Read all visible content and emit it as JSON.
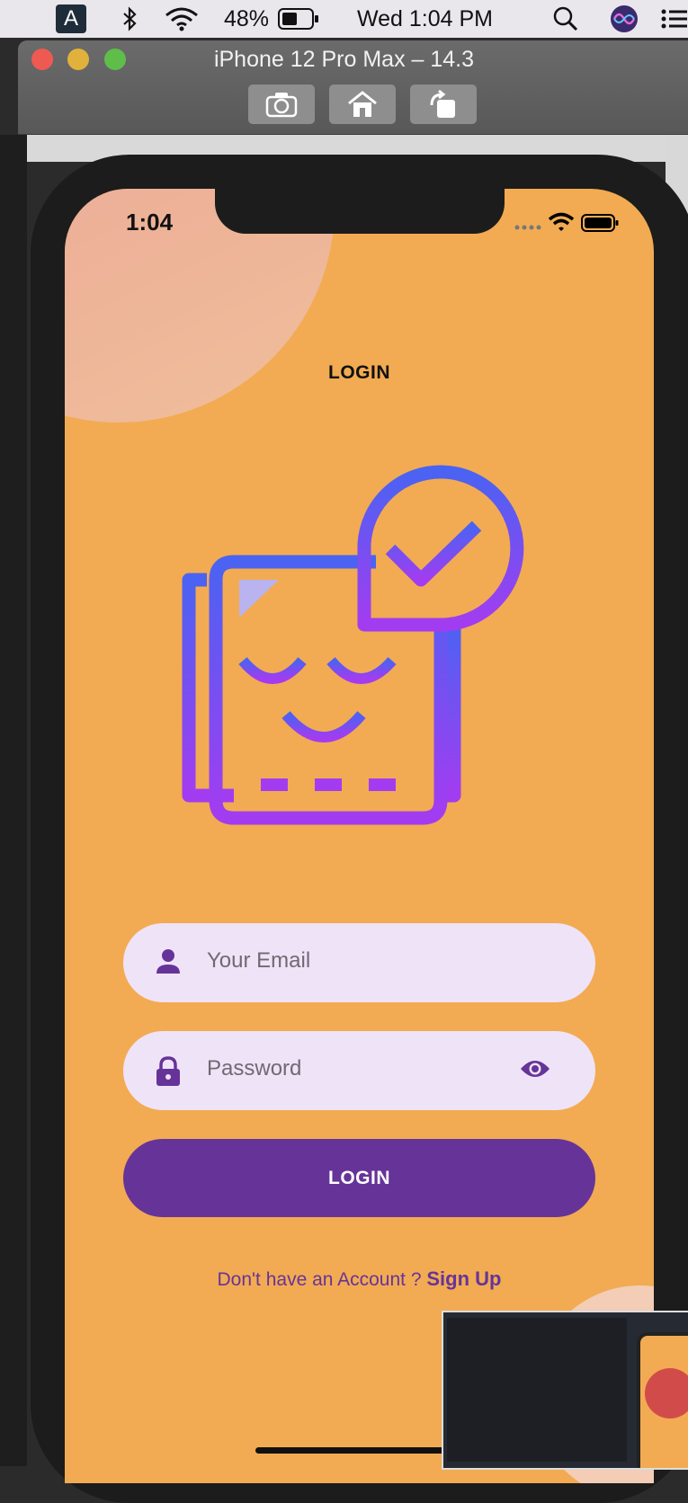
{
  "menubar": {
    "input_source": "A",
    "battery_percent": "48%",
    "clock": "Wed 1:04 PM"
  },
  "simulator": {
    "title": "iPhone 12 Pro Max – 14.3",
    "buttons": [
      "screenshot-icon",
      "home-icon",
      "rotate-icon"
    ]
  },
  "status_bar": {
    "time": "1:04"
  },
  "page": {
    "heading": "LOGIN",
    "email_placeholder": "Your Email",
    "password_placeholder": "Password",
    "login_button": "LOGIN",
    "signup_prompt": "Don't have an Account ? ",
    "signup_link": "Sign Up"
  },
  "colors": {
    "background": "#f2ab52",
    "field_bg": "#efe3f8",
    "primary": "#663498",
    "illustration_gradient": [
      "#4a63f2",
      "#a33cf0"
    ]
  }
}
